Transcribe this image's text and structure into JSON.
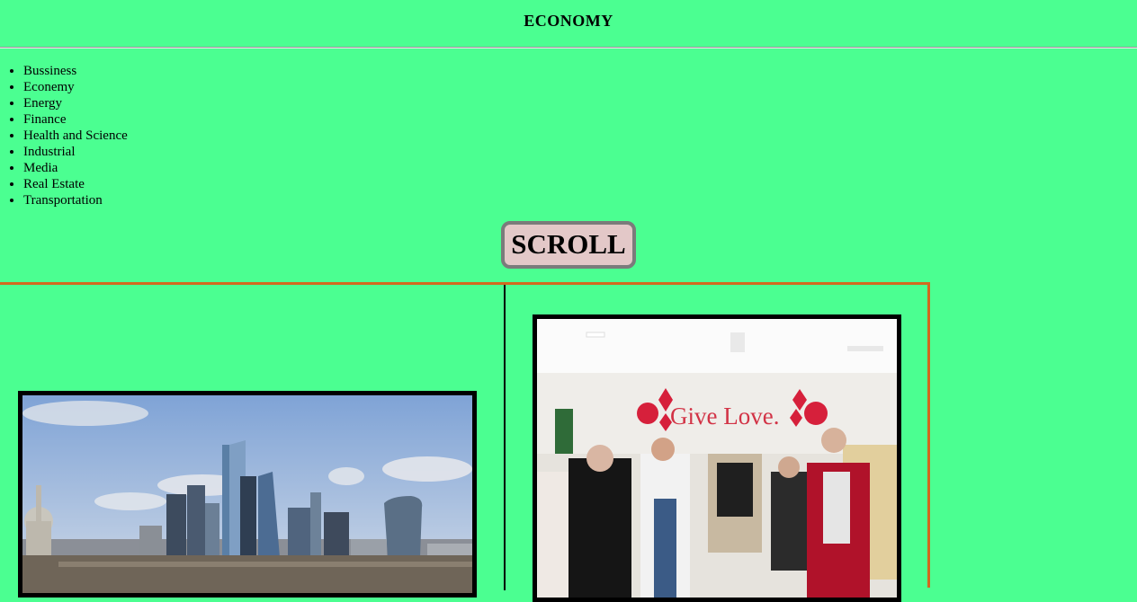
{
  "header": {
    "title": "ECONOMY"
  },
  "nav": {
    "items": [
      "Bussiness",
      "Econemy",
      "Energy",
      "Finance",
      "Health and Science",
      "Industrial",
      "Media",
      "Real Estate",
      "Transportation"
    ]
  },
  "scroll_button": {
    "label": "SCROLL"
  },
  "gallery": {
    "left_image": "city-skyline-photo",
    "right_image": "department-store-shoppers-photo",
    "right_image_sign": "Give Love.",
    "border_color": "#d1691f",
    "background_color": "#4bff91"
  }
}
